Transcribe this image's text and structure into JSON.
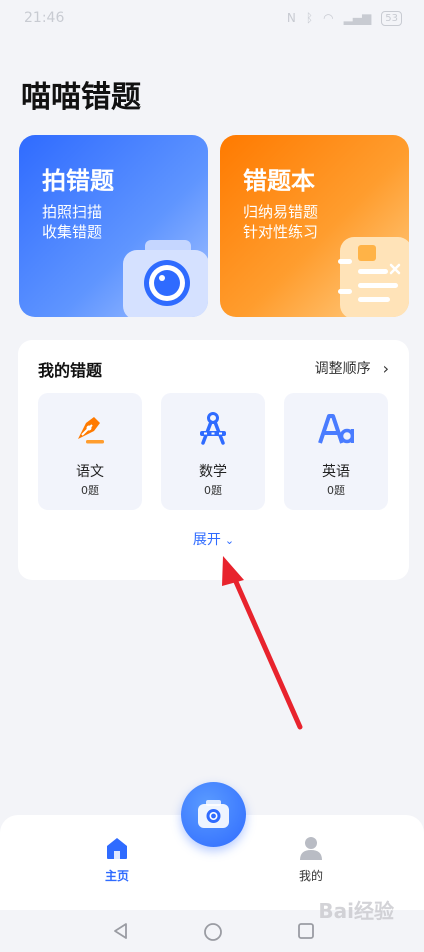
{
  "status_bar": {
    "time": "21:46",
    "battery": "53"
  },
  "page_title": "喵喵错题",
  "cards": {
    "capture": {
      "title": "拍错题",
      "line1": "拍照扫描",
      "line2": "收集错题"
    },
    "notebook": {
      "title": "错题本",
      "line1": "归纳易错题",
      "line2": "针对性练习"
    }
  },
  "my_mistakes": {
    "title": "我的错题",
    "reorder_label": "调整顺序",
    "subjects": [
      {
        "name": "语文",
        "count": "0题",
        "icon": "pen-icon"
      },
      {
        "name": "数学",
        "count": "0题",
        "icon": "compass-icon"
      },
      {
        "name": "英语",
        "count": "0题",
        "icon": "letters-icon"
      }
    ],
    "expand_label": "展开"
  },
  "bottom_nav": {
    "home_label": "主页",
    "mine_label": "我的"
  },
  "watermark": "Bai经验",
  "colors": {
    "primary": "#2f6bff",
    "orange": "#ff7a00",
    "background": "#f3f4f8"
  }
}
